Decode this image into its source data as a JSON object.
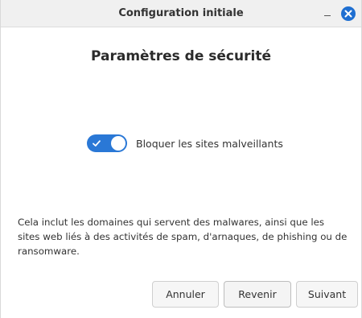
{
  "window": {
    "title": "Configuration initiale"
  },
  "titlebar": {
    "minimize_icon": "minimize-icon",
    "close_icon": "close-icon",
    "close_color": "#1f6fd1"
  },
  "page": {
    "heading": "Paramètres de sécurité"
  },
  "toggle": {
    "label": "Bloquer les sites malveillants",
    "state": "on",
    "accent_color": "#2a78d6"
  },
  "description": "Cela inclut les domaines qui servent des malwares, ainsi que les sites web liés à des activités de spam, d'arnaques, de phishing ou de ransomware.",
  "buttons": {
    "cancel": "Annuler",
    "back": "Revenir",
    "next": "Suivant"
  }
}
